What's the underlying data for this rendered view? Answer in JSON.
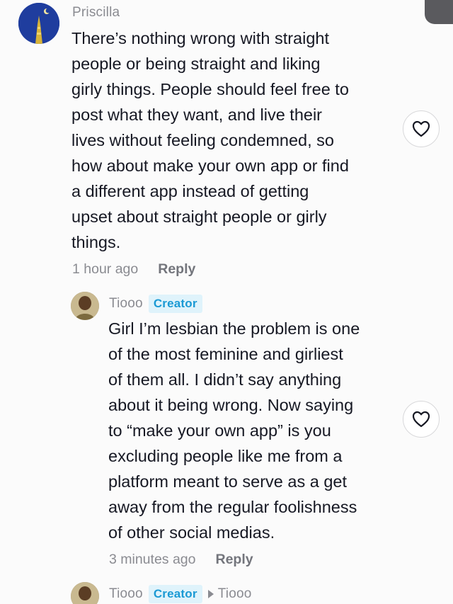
{
  "comment": {
    "author": "Priscilla",
    "text": "There’s nothing wrong with straight\npeople or being straight and liking\ngirly things. People should feel free to\npost what they want, and live their\nlives without feeling condemned, so\nhow about make your own app or find\na different app instead of getting\nupset about straight people or girly\nthings.",
    "time": "1 hour ago",
    "reply_label": "Reply"
  },
  "reply": {
    "author": "Tiooo",
    "badge": "Creator",
    "text": "Girl I’m lesbian the problem is one\nof the most feminine and girliest\nof them all. I didn’t say anything\nabout it being wrong. Now saying\nto “make your own app” is you\nexcluding people like me from a\nplatform meant to serve as a get\naway from the regular foolishness\nof other social medias.",
    "time": "3 minutes ago",
    "reply_label": "Reply"
  },
  "reply2": {
    "author": "Tiooo",
    "badge": "Creator",
    "reply_to": "Tiooo"
  },
  "icons": {
    "like": "heart-outline-icon"
  },
  "colors": {
    "creator_badge_bg": "#dff3fb",
    "creator_badge_text": "#1b9ad4",
    "meta_text": "#8a8b91"
  }
}
